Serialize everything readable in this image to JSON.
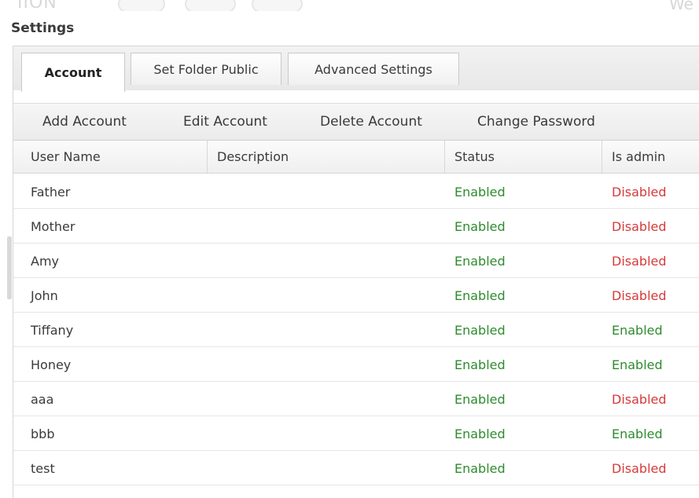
{
  "window": {
    "title": "Settings"
  },
  "tabs": [
    {
      "label": "Account"
    },
    {
      "label": "Set Folder Public"
    },
    {
      "label": "Advanced Settings"
    }
  ],
  "toolbar": {
    "add": "Add Account",
    "edit": "Edit Account",
    "delete": "Delete Account",
    "change_password": "Change Password"
  },
  "columns": {
    "username": "User Name",
    "description": "Description",
    "status": "Status",
    "is_admin": "Is admin"
  },
  "rows": [
    {
      "username": "Father",
      "description": "",
      "status": "Enabled",
      "is_admin": "Disabled"
    },
    {
      "username": "Mother",
      "description": "",
      "status": "Enabled",
      "is_admin": "Disabled"
    },
    {
      "username": "Amy",
      "description": "",
      "status": "Enabled",
      "is_admin": "Disabled"
    },
    {
      "username": "John",
      "description": "",
      "status": "Enabled",
      "is_admin": "Disabled"
    },
    {
      "username": "Tiffany",
      "description": "",
      "status": "Enabled",
      "is_admin": "Enabled"
    },
    {
      "username": "Honey",
      "description": "",
      "status": "Enabled",
      "is_admin": "Enabled"
    },
    {
      "username": "aaa",
      "description": "",
      "status": "Enabled",
      "is_admin": "Disabled"
    },
    {
      "username": "bbb",
      "description": "",
      "status": "Enabled",
      "is_admin": "Enabled"
    },
    {
      "username": "test",
      "description": "",
      "status": "Enabled",
      "is_admin": "Disabled"
    }
  ],
  "colors": {
    "enabled": "#2e8b2e",
    "disabled": "#d63a3a"
  }
}
